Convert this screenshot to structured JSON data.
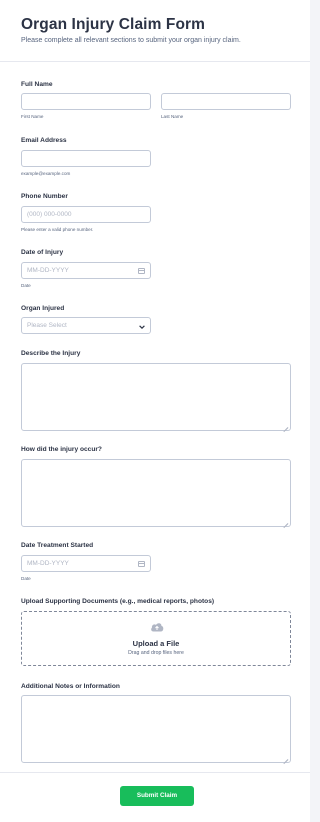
{
  "form": {
    "title": "Organ Injury Claim Form",
    "subtitle": "Please complete all relevant sections to submit your organ injury claim."
  },
  "full_name": {
    "label": "Full Name",
    "first_sub": "First Name",
    "last_sub": "Last Name",
    "first_value": "",
    "last_value": ""
  },
  "email": {
    "label": "Email Address",
    "value": "",
    "sublabel": "example@example.com"
  },
  "phone": {
    "label": "Phone Number",
    "placeholder": "(000) 000-0000",
    "sublabel": "Please enter a valid phone number."
  },
  "date_of_injury": {
    "label": "Date of Injury",
    "placeholder": "MM-DD-YYYY",
    "sublabel": "Date",
    "icon": "calendar-icon"
  },
  "organ_injured": {
    "label": "Organ Injured",
    "selected": "Please Select",
    "icon": "chevron-down-icon"
  },
  "describe_injury": {
    "label": "Describe the Injury",
    "value": ""
  },
  "how_occurred": {
    "label": "How did the injury occur?",
    "value": ""
  },
  "treatment_date": {
    "label": "Date Treatment Started",
    "placeholder": "MM-DD-YYYY",
    "sublabel": "Date",
    "icon": "calendar-icon"
  },
  "upload": {
    "label": "Upload Supporting Documents (e.g., medical reports, photos)",
    "title": "Upload a File",
    "subtitle": "Drag and drop files here",
    "icon": "cloud-upload-icon"
  },
  "additional_notes": {
    "label": "Additional Notes or Information",
    "value": ""
  },
  "submit": {
    "label": "Submit Claim"
  },
  "colors": {
    "accent": "#18bd5b",
    "text": "#2c3345",
    "muted": "#57647e",
    "border": "#c3cad8"
  }
}
